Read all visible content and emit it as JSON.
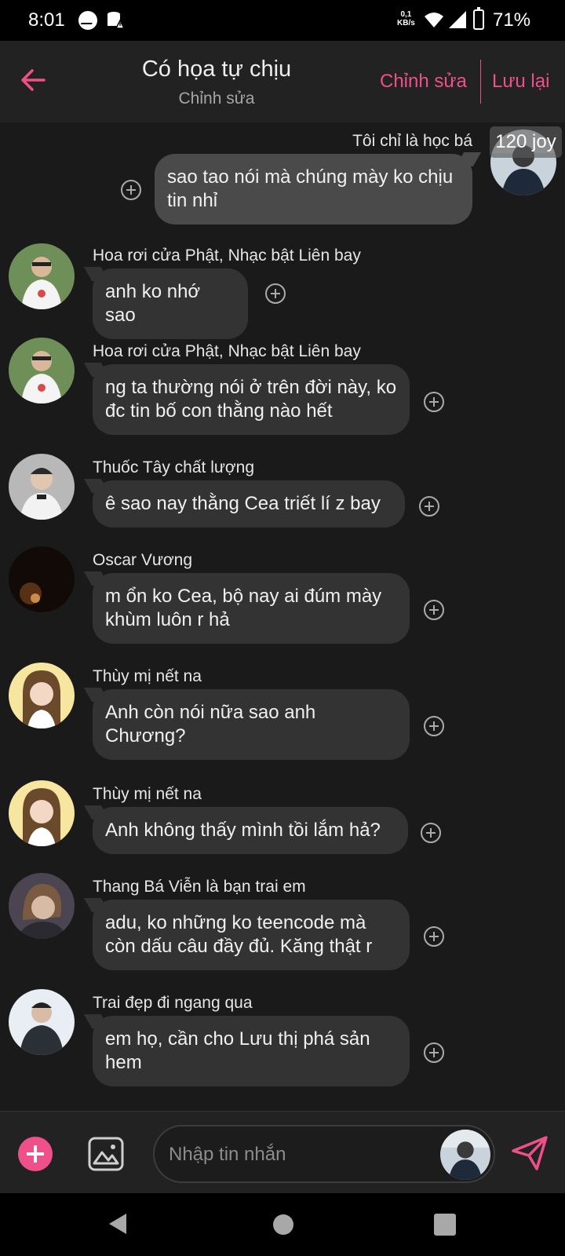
{
  "status_bar": {
    "time": "8:01",
    "net_speed_top": "0,1",
    "net_speed_bottom": "KB/s",
    "battery": "71%",
    "icons": [
      "messenger-icon",
      "data-warning-icon",
      "wifi-icon",
      "signal-icon",
      "battery-charging-icon"
    ]
  },
  "header": {
    "title": "Có họa tự chịu",
    "subtitle": "Chỉnh sửa",
    "edit_label": "Chỉnh sửa",
    "save_label": "Lưu lại",
    "accent_color": "#f0508a"
  },
  "messages": [
    {
      "sender": "Tôi chỉ là học bá",
      "text": "sao tao nói mà chúng mày ko chịu tin nhỉ",
      "own": true,
      "badge": "120 joy"
    },
    {
      "sender": "Hoa rơi cửa Phật, Nhạc bật Liên bay",
      "text": "anh ko nhớ sao"
    },
    {
      "sender": "Hoa rơi cửa Phật, Nhạc bật Liên bay",
      "text": "ng ta thường nói ở trên đời này, ko đc tin bố con thằng nào hết"
    },
    {
      "sender": "Thuốc Tây chất lượng",
      "text": "ê sao nay thằng Cea triết lí z bay"
    },
    {
      "sender": "Oscar Vương",
      "text": "m ổn ko Cea, bộ nay ai đúm mày khùm luôn r hả"
    },
    {
      "sender": "Thùy mị nết na",
      "text": "Anh còn nói nữa sao anh Chương?"
    },
    {
      "sender": "Thùy mị nết na",
      "text": "Anh không thấy mình tồi lắm hả?"
    },
    {
      "sender": "Thang Bá Viễn là bạn trai em",
      "text": "adu, ko những ko teencode mà còn dấu câu đầy đủ. Kăng thật r"
    },
    {
      "sender": "Trai đẹp đi ngang qua",
      "text": "em họ, cần cho Lưu thị phá sản hem"
    }
  ],
  "composer": {
    "placeholder": "Nhập tin nhắn"
  }
}
